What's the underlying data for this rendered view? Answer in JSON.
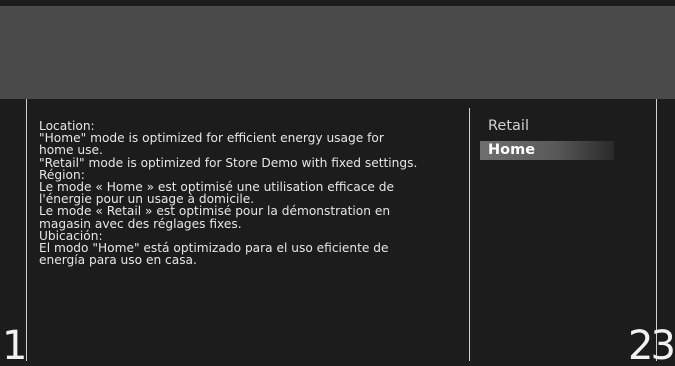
{
  "description_lines": [
    "Location:",
    "\"Home\" mode is optimized for efficient energy usage for",
    "home use.",
    "\"Retail\" mode is optimized for Store Demo with fixed settings.",
    "Région:",
    "Le mode « Home » est optimisé une utilisation efficace de",
    "l'énergie pour un usage à domicile.",
    "Le mode « Retail » est optimisé pour la démonstration en",
    "magasin avec des réglages fixes.",
    "Ubicación:",
    "El modo \"Home\" está optimizado para el uso eficiente de",
    "energía para uso en casa."
  ],
  "menu": {
    "items": [
      {
        "label": "Retail",
        "selected": false
      },
      {
        "label": "Home",
        "selected": true
      }
    ]
  },
  "page_numbers": {
    "left": "1",
    "right": "23"
  },
  "colors": {
    "banner": "#4a4a4a",
    "background": "#1c1c1c",
    "highlight": "#6f6f6f"
  }
}
